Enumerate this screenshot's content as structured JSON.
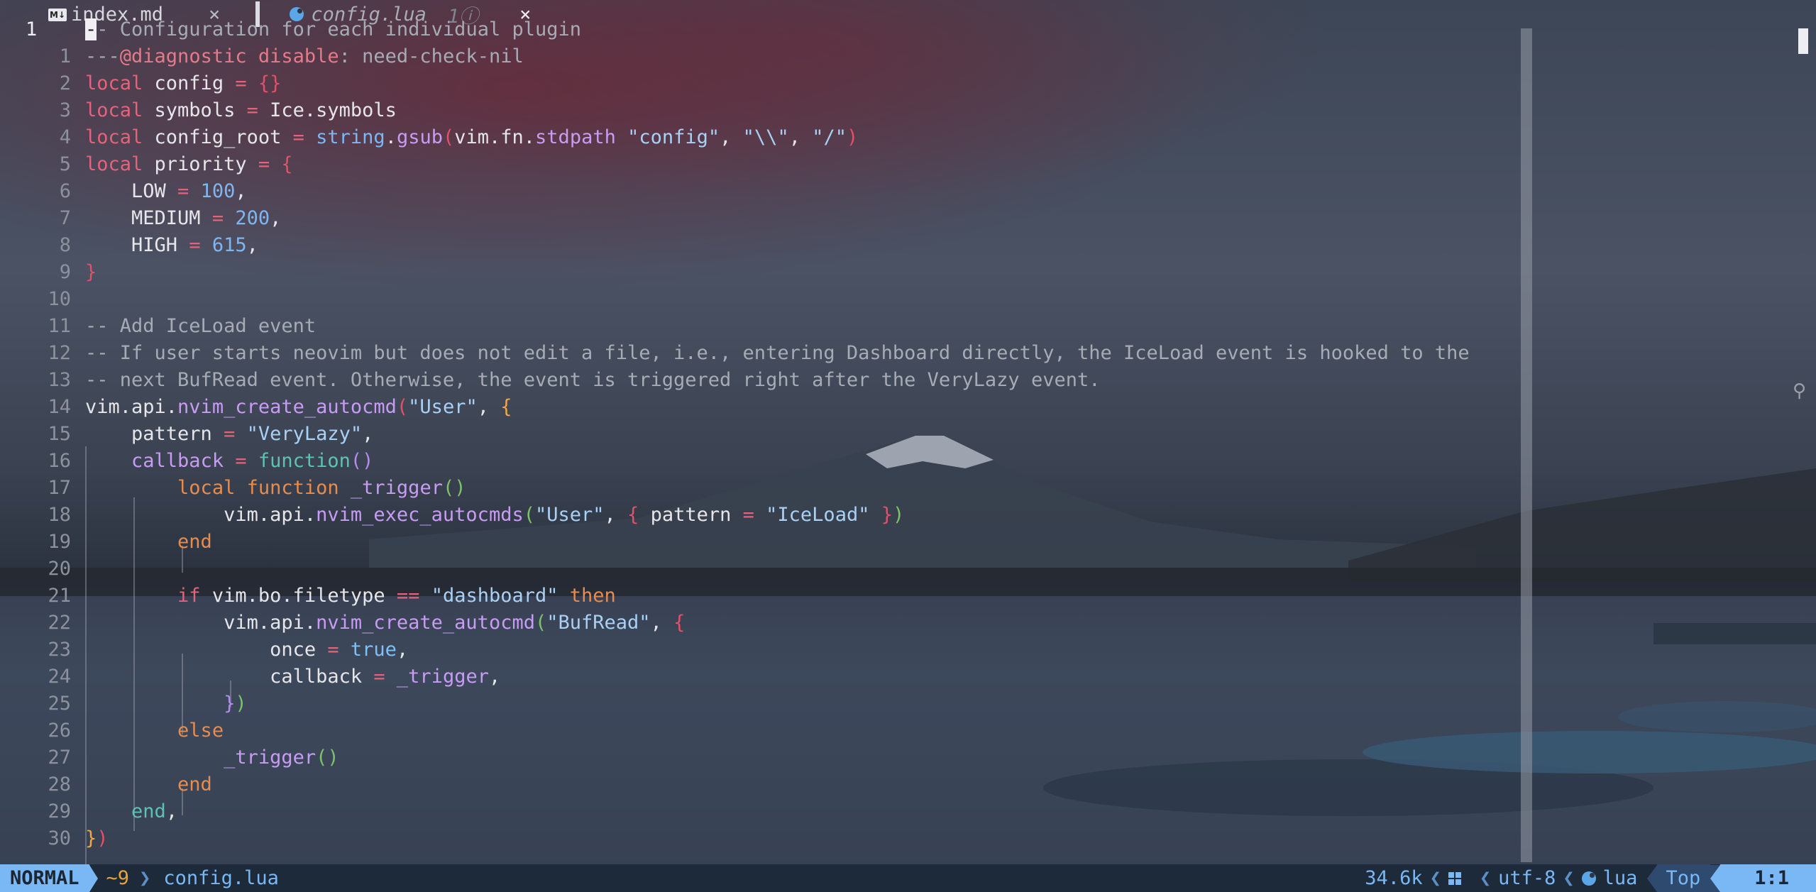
{
  "tabs": [
    {
      "icon": "markdown-icon",
      "icon_text": "M↓",
      "label": "index.md",
      "close": "×"
    },
    {
      "icon": "lua-file-icon",
      "label": "config.lua",
      "count": "1",
      "close": "×"
    }
  ],
  "editor": {
    "cursor_line_number": "1",
    "line_numbers": [
      "1",
      "2",
      "3",
      "4",
      "5",
      "6",
      "7",
      "8",
      "9",
      "10",
      "11",
      "12",
      "13",
      "14",
      "15",
      "16",
      "17",
      "18",
      "19",
      "20",
      "21",
      "22",
      "23",
      "24",
      "25",
      "26",
      "27",
      "28",
      "29",
      "30"
    ]
  },
  "statusbar": {
    "mode": "NORMAL",
    "git": "~9",
    "filename": "config.lua",
    "filesize": "34.6k",
    "encoding": "utf-8",
    "filetype": "lua",
    "scroll": "Top",
    "position": "1:1"
  },
  "colors": {
    "accent": "#7ab8f5",
    "keyword": "#e5637a",
    "function": "#c79cf2",
    "string": "#a9d0f5",
    "comment": "#a7abb5"
  }
}
